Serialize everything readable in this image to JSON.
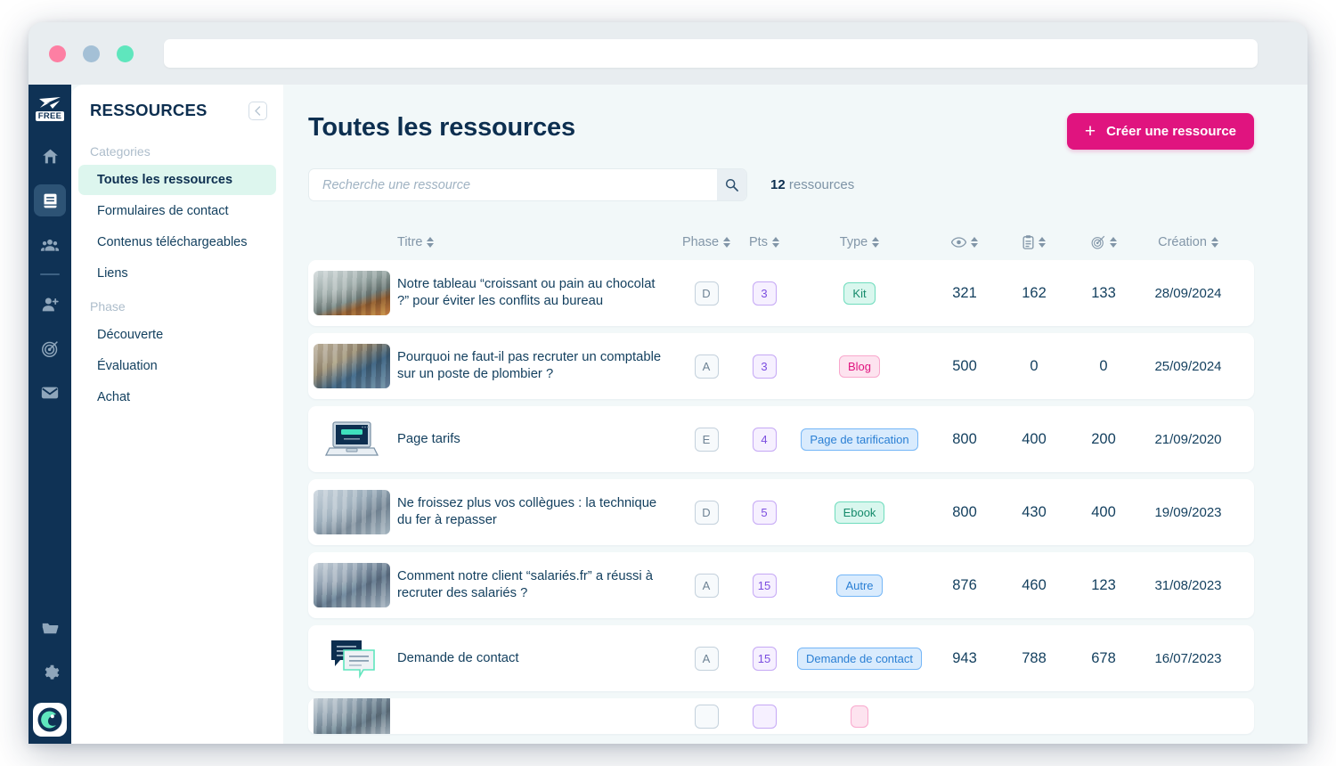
{
  "browser": {
    "url_value": "",
    "url_placeholder": "",
    "traffic_lights": [
      "close",
      "minimize",
      "zoom"
    ]
  },
  "icon_rail": {
    "logo_label": "FREE",
    "items": [
      {
        "name": "home-icon",
        "label": "Accueil"
      },
      {
        "name": "book-icon",
        "label": "Ressources",
        "active": true
      },
      {
        "name": "people-icon",
        "label": "Contacts"
      },
      {
        "name": "user-plus-icon",
        "label": "Ajouter un contact"
      },
      {
        "name": "target-icon",
        "label": "Objectifs"
      },
      {
        "name": "envelope-icon",
        "label": "Messages"
      },
      {
        "name": "folder-icon",
        "label": "Dossiers"
      },
      {
        "name": "gear-icon",
        "label": "Paramètres"
      }
    ]
  },
  "sidebar": {
    "title": "RESSOURCES",
    "collapse_icon": "chevron-left-icon",
    "groups": [
      {
        "label": "Categories",
        "items": [
          {
            "label": "Toutes les ressources",
            "active": true
          },
          {
            "label": "Formulaires de contact",
            "active": false
          },
          {
            "label": "Contenus téléchargeables",
            "active": false
          },
          {
            "label": "Liens",
            "active": false
          }
        ]
      },
      {
        "label": "Phase",
        "items": [
          {
            "label": "Découverte",
            "active": false
          },
          {
            "label": "Évaluation",
            "active": false
          },
          {
            "label": "Achat",
            "active": false
          }
        ]
      }
    ]
  },
  "main": {
    "page_title": "Toutes les ressources",
    "create_button": {
      "label": "Créer une ressource",
      "plus": "+",
      "color": "#e0147f"
    },
    "search": {
      "value": "",
      "placeholder": "Recherche une ressource",
      "icon": "search-icon"
    },
    "result_count": {
      "number": "12",
      "label": "ressources"
    },
    "columns": [
      {
        "key": "thumb",
        "label": "",
        "sortable": false
      },
      {
        "key": "title",
        "label": "Titre",
        "sortable": true
      },
      {
        "key": "phase",
        "label": "Phase",
        "sortable": true
      },
      {
        "key": "pts",
        "label": "Pts",
        "sortable": true
      },
      {
        "key": "type",
        "label": "Type",
        "sortable": true
      },
      {
        "key": "views",
        "label": "",
        "icon": "eye-icon",
        "sortable": true
      },
      {
        "key": "forms",
        "label": "",
        "icon": "clipboard-icon",
        "sortable": true
      },
      {
        "key": "goals",
        "label": "",
        "icon": "target-icon",
        "sortable": true
      },
      {
        "key": "created",
        "label": "Création",
        "sortable": true
      }
    ],
    "rows": [
      {
        "thumb": "photo-croissant-office-fight",
        "title": "Notre tableau “croissant ou pain au chocolat ?” pour éviter les conflits au bureau",
        "phase": "D",
        "pts": "3",
        "type": "Kit",
        "type_style": "kit",
        "views": "321",
        "forms": "162",
        "goals": "133",
        "created": "28/09/2024"
      },
      {
        "thumb": "photo-accountant-plumber",
        "title": "Pourquoi ne faut-il pas recruter un comptable sur un poste de plombier ?",
        "phase": "A",
        "pts": "3",
        "type": "Blog",
        "type_style": "blog",
        "views": "500",
        "forms": "0",
        "goals": "0",
        "created": "25/09/2024"
      },
      {
        "thumb": "laptop-illustration",
        "title": "Page tarifs",
        "phase": "E",
        "pts": "4",
        "type": "Page de tarification",
        "type_style": "page",
        "views": "800",
        "forms": "400",
        "goals": "200",
        "created": "21/09/2020"
      },
      {
        "thumb": "photo-shirt-colleagues",
        "title": "Ne froissez plus vos collègues : la technique du fer à repasser",
        "phase": "D",
        "pts": "5",
        "type": "Ebook",
        "type_style": "ebook",
        "views": "800",
        "forms": "430",
        "goals": "400",
        "created": "19/09/2023"
      },
      {
        "thumb": "photo-crowd-employees",
        "title": "Comment notre client “salariés.fr” a réussi à recruter des salariés ?",
        "phase": "A",
        "pts": "15",
        "type": "Autre",
        "type_style": "autre",
        "views": "876",
        "forms": "460",
        "goals": "123",
        "created": "31/08/2023"
      },
      {
        "thumb": "speech-bubbles-illustration",
        "title": "Demande de contact",
        "phase": "A",
        "pts": "15",
        "type": "Demande de contact",
        "type_style": "demande",
        "views": "943",
        "forms": "788",
        "goals": "678",
        "created": "16/07/2023"
      },
      {
        "thumb": "photo-team-standing",
        "title": "",
        "phase": "",
        "pts": "",
        "type": "",
        "type_style": "blog",
        "views": "",
        "forms": "",
        "goals": "",
        "created": ""
      }
    ]
  },
  "colors": {
    "brand_pink": "#e0147f",
    "navy": "#0f3255",
    "mint_active": "#ddf6ee",
    "canvas": "#f2f8f9"
  }
}
